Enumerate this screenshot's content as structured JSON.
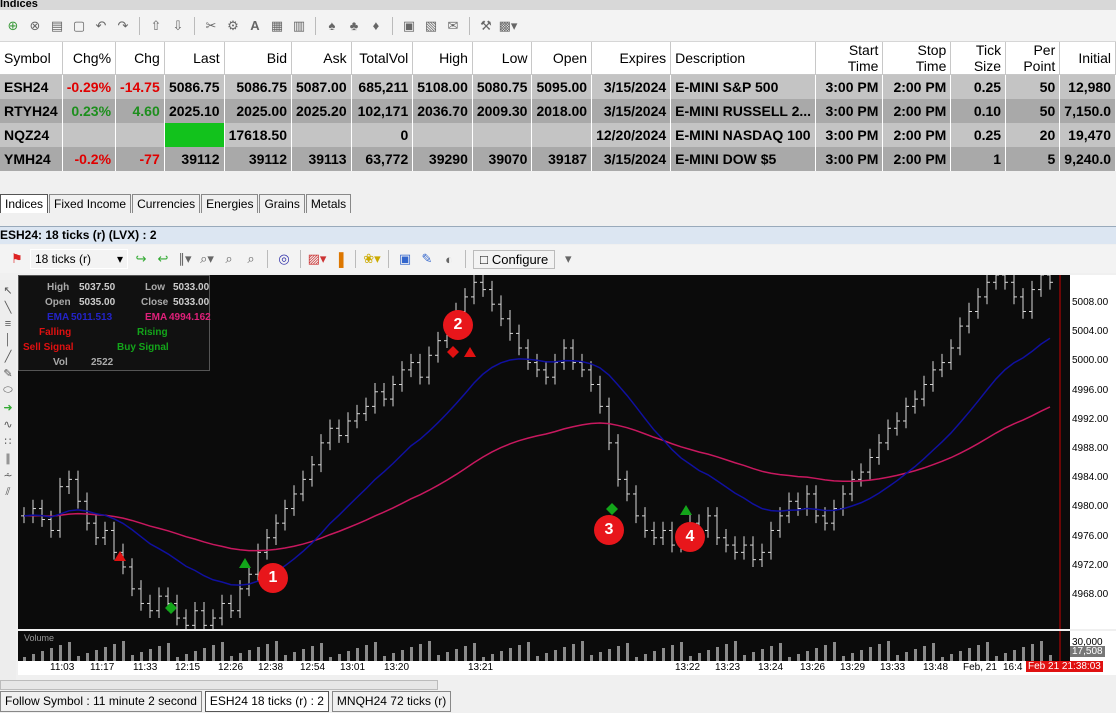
{
  "window": {
    "title": "Indices"
  },
  "table": {
    "columns": [
      "Symbol",
      "Chg%",
      "Chg",
      "Last",
      "Bid",
      "Ask",
      "TotalVol",
      "High",
      "Low",
      "Open",
      "Expires",
      "Description",
      "Start Time",
      "Stop Time",
      "Tick Size",
      "Per Point",
      "Initial"
    ],
    "rows": [
      {
        "symbol": "ESH24",
        "chgp": "-0.29%",
        "chg": "-14.75",
        "last": "5086.75",
        "bid": "5086.75",
        "ask": "5087.00",
        "vol": "685,211",
        "high": "5108.00",
        "low": "5080.75",
        "open": "5095.00",
        "expires": "3/15/2024",
        "desc": "E-MINI S&P 500",
        "start": "3:00 PM",
        "stop": "2:00 PM",
        "tick": "0.25",
        "pp": "50",
        "initial": "12,980"
      },
      {
        "symbol": "RTYH24",
        "chgp": "0.23%",
        "chg": "4.60",
        "last": "2025.10",
        "bid": "2025.00",
        "ask": "2025.20",
        "vol": "102,171",
        "high": "2036.70",
        "low": "2009.30",
        "open": "2018.00",
        "expires": "3/15/2024",
        "desc": "E-MINI RUSSELL 2...",
        "start": "3:00 PM",
        "stop": "2:00 PM",
        "tick": "0.10",
        "pp": "50",
        "initial": "7,150.0"
      },
      {
        "symbol": "NQZ24",
        "chgp": "",
        "chg": "",
        "last": "",
        "bid": "17618.50",
        "ask": "",
        "vol": "0",
        "high": "",
        "low": "",
        "open": "",
        "expires": "12/20/2024",
        "desc": "E-MINI NASDAQ 100",
        "start": "3:00 PM",
        "stop": "2:00 PM",
        "tick": "0.25",
        "pp": "20",
        "initial": "19,470"
      },
      {
        "symbol": "YMH24",
        "chgp": "-0.2%",
        "chg": "-77",
        "last": "39112",
        "bid": "39112",
        "ask": "39113",
        "vol": "63,772",
        "high": "39290",
        "low": "39070",
        "open": "39187",
        "expires": "3/15/2024",
        "desc": "E-MINI DOW $5",
        "start": "3:00 PM",
        "stop": "2:00 PM",
        "tick": "1",
        "pp": "5",
        "initial": "9,240.0"
      }
    ]
  },
  "tabs": [
    "Indices",
    "Fixed Income",
    "Currencies",
    "Energies",
    "Grains",
    "Metals"
  ],
  "chart": {
    "title": "ESH24: 18 ticks (r) (LVX) : 2",
    "interval": "18 ticks (r)",
    "configure_label": "Configure",
    "info": {
      "high_label": "High",
      "high": "5037.50",
      "low_label": "Low",
      "low": "5033.00",
      "open_label": "Open",
      "open": "5035.00",
      "close_label": "Close",
      "close": "5033.00",
      "ema1_label": "EMA",
      "ema1": "5011.513",
      "ema2_label": "EMA",
      "ema2": "4994.162",
      "falling": "Falling",
      "rising": "Rising",
      "sell": "Sell Signal",
      "buy": "Buy Signal",
      "vol_label": "Vol",
      "vol": "2522"
    },
    "price_ticks": [
      "5008.00",
      "5004.00",
      "5000.00",
      "4996.00",
      "4992.00",
      "4988.00",
      "4984.00",
      "4980.00",
      "4976.00",
      "4972.00",
      "4968.00"
    ],
    "volume_label": "Volume",
    "vol_axis": {
      "top": "30,000",
      "bottom": "17,508"
    },
    "time_ticks": [
      "11:03",
      "11:17",
      "11:33",
      "12:15",
      "12:26",
      "12:38",
      "12:54",
      "13:01",
      "13:20",
      "13:21",
      "13:22",
      "13:23",
      "13:24",
      "13:26",
      "13:29",
      "13:33",
      "13:48",
      "Feb, 21",
      "16:4"
    ],
    "current_time": "Feb 21 21:38:03",
    "markers": [
      "1",
      "2",
      "3",
      "4"
    ],
    "colors": {
      "ema_fast": "#1010a0",
      "ema_slow": "#c8185f",
      "buy": "#13a51a",
      "sell": "#e01111"
    }
  },
  "bottom": {
    "follow": "Follow Symbol : 11 minute 2 second",
    "tab1": "ESH24 18 ticks (r) : 2",
    "tab2": "MNQH24 72 ticks (r)"
  }
}
